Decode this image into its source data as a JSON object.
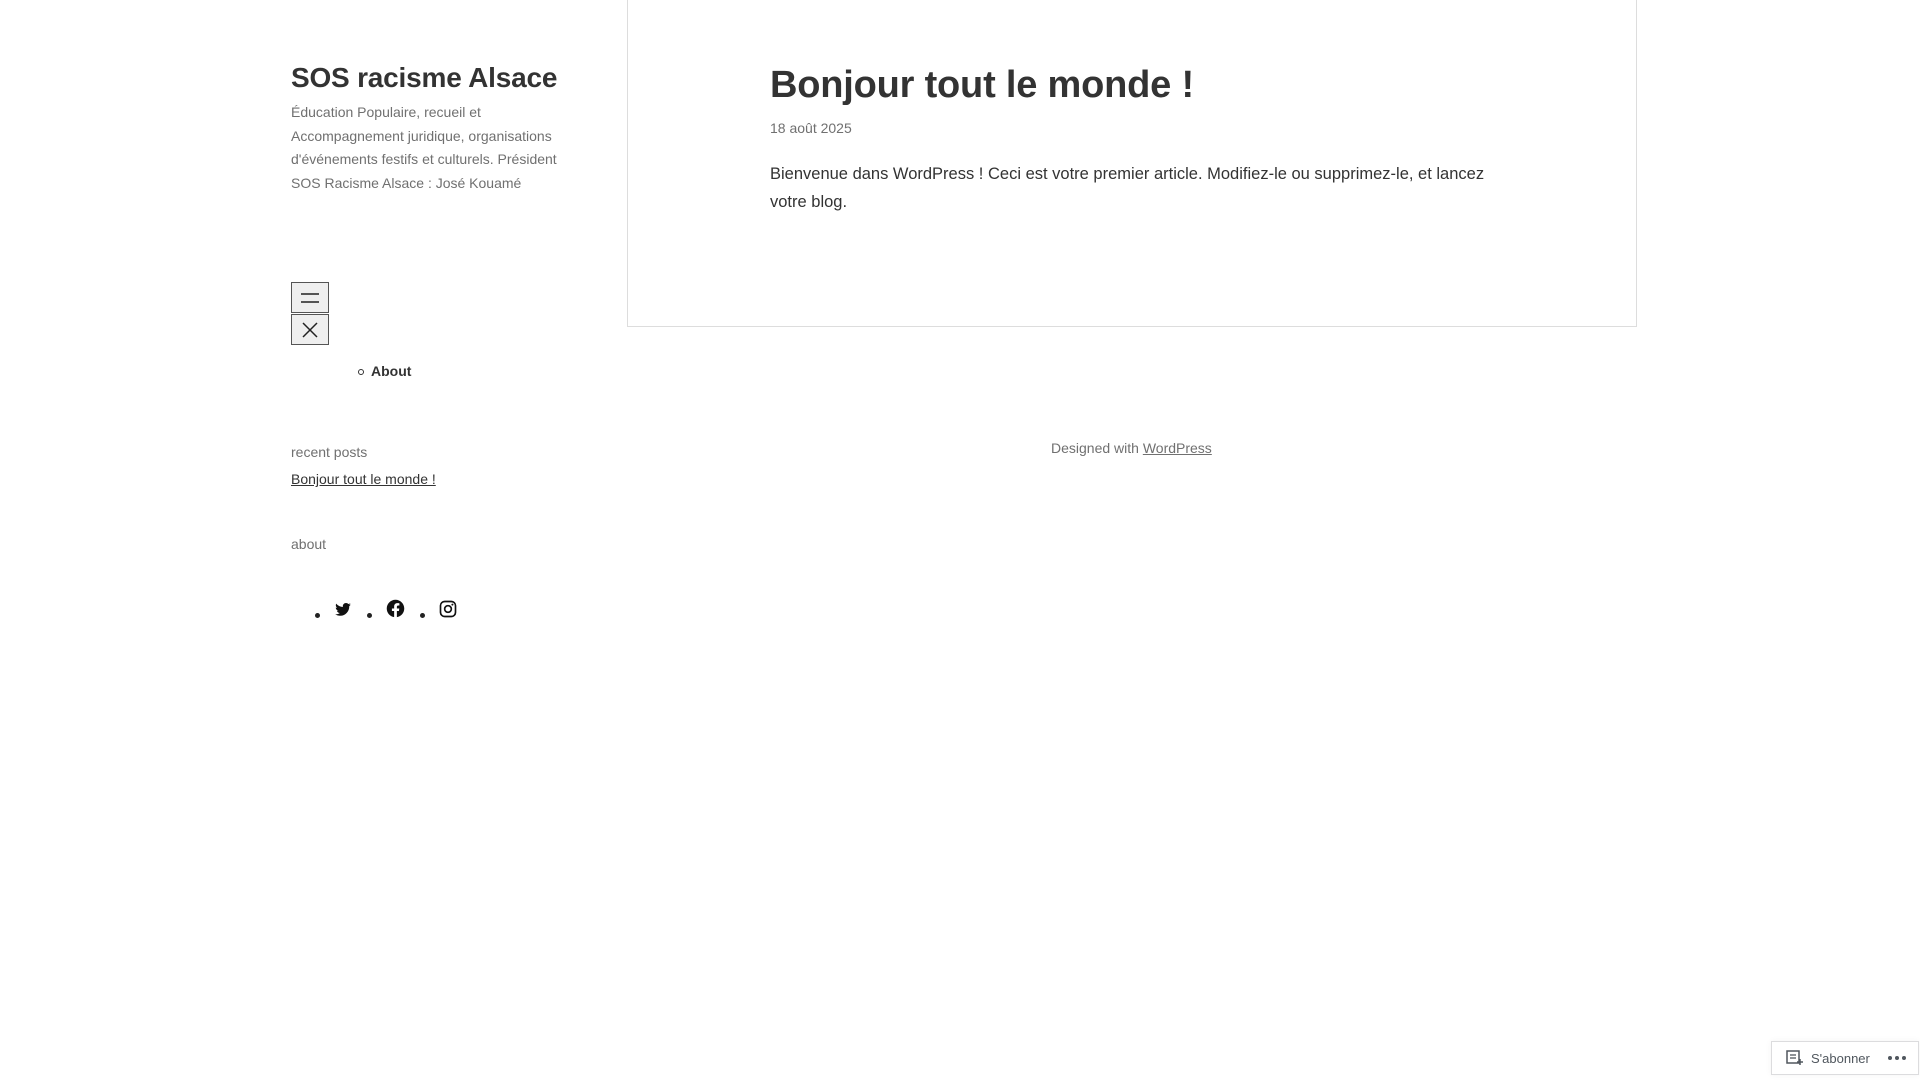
{
  "site": {
    "title": "SOS racisme Alsace",
    "description": "Éducation Populaire, recueil et Accompagnement juridique, organisations d'événements festifs et culturels. Président SOS Racisme Alsace : José Kouamé"
  },
  "nav": {
    "items": [
      {
        "label": "About"
      }
    ]
  },
  "widgets": {
    "recent_posts": {
      "title": "recent posts",
      "items": [
        {
          "label": "Bonjour tout le monde !"
        }
      ]
    },
    "about": {
      "title": "about"
    }
  },
  "social": [
    {
      "icon": "twitter-icon"
    },
    {
      "icon": "facebook-icon"
    },
    {
      "icon": "instagram-icon"
    }
  ],
  "post": {
    "title": "Bonjour tout le monde !",
    "date": "18 août 2025",
    "body": "Bienvenue dans WordPress ! Ceci est votre premier article. Modifiez-le ou supprimez-le, et lancez votre blog."
  },
  "footer": {
    "prefix": "Designed with ",
    "link": "WordPress"
  },
  "subscribe": {
    "label": "S'abonner"
  }
}
